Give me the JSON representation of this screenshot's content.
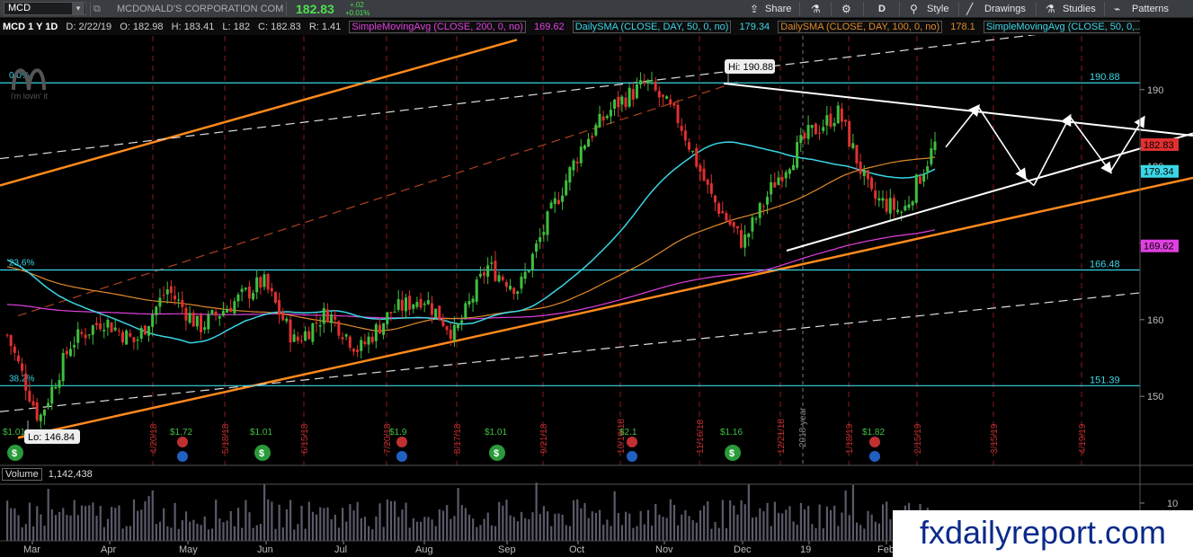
{
  "toolbar": {
    "symbol": "MCD",
    "company": "MCDONALD'S CORPORATION COM",
    "last": "182.83",
    "change": "+.02",
    "change_pct": "+0.01%",
    "share_label": "Share",
    "interval_label": "D",
    "style_label": "Style",
    "drawings_label": "Drawings",
    "studies_label": "Studies",
    "patterns_label": "Patterns"
  },
  "studies": {
    "title": "MCD 1 Y 1D",
    "date": "D: 2/22/19",
    "open": "O: 182.98",
    "high": "H: 183.41",
    "low": "L: 182",
    "close": "C: 182.83",
    "range": "R: 1.41",
    "sma200_label": "SimpleMovingAvg (CLOSE, 200, 0, no)",
    "sma200_value": "169.62",
    "sma50_label": "DailySMA (CLOSE, DAY, 50, 0, no)",
    "sma50_value": "179.34",
    "sma100_label": "DailySMA (CLOSE, DAY, 100, 0, no)",
    "sma100_value": "178.1",
    "sma50b_label": "SimpleMovingAvg (CLOSE, 50, 0,..."
  },
  "logo_text": "i'm lovin' it",
  "watermark": "fxdailyreport.com",
  "volume": {
    "label": "Volume",
    "value": "1,142,438",
    "axis_tick": "10"
  },
  "colors": {
    "background": "#000000",
    "up_candle": "#3fbf3f",
    "down_candle": "#e03030",
    "sma50": "#3ad6e6",
    "sma100": "#e08a2a",
    "sma200": "#e040e0",
    "fib_line": "#3ad6e6",
    "channel_line": "#ff8a1c",
    "trend_line": "#ffffff"
  },
  "chart_data": {
    "type": "candlestick",
    "symbol": "MCD",
    "period": "1 Y 1D",
    "ylim": [
      141,
      197
    ],
    "y_ticks": [
      150,
      160,
      170,
      180,
      190
    ],
    "x_months": [
      "Mar",
      "Apr",
      "May",
      "Jun",
      "Jul",
      "Aug",
      "Sep",
      "Oct",
      "Nov",
      "Dec",
      "19",
      "Feb"
    ],
    "year_marker": "2018 year",
    "price_labels": [
      {
        "text": "190.88",
        "value": 190.88,
        "color": "#3ad6e6",
        "style": "text"
      },
      {
        "text": "182.83",
        "value": 182.83,
        "color": "#e03030",
        "style": "box"
      },
      {
        "text": "179.34",
        "value": 179.34,
        "color": "#3ad6e6",
        "style": "box"
      },
      {
        "text": "169.62",
        "value": 169.62,
        "color": "#e040e0",
        "style": "box"
      },
      {
        "text": "166.48",
        "value": 166.48,
        "color": "#3ad6e6",
        "style": "text"
      },
      {
        "text": "151.39",
        "value": 151.39,
        "color": "#3ad6e6",
        "style": "text"
      }
    ],
    "fib_levels": [
      {
        "label": "0.0%",
        "value": 190.88
      },
      {
        "label": "23.6%",
        "value": 166.48
      },
      {
        "label": "38.2%",
        "value": 151.39
      }
    ],
    "high_label": "Hi: 190.88",
    "low_label": "Lo: 146.84",
    "event_dates": [
      "4/20/18",
      "5/18/18",
      "6/15/18",
      "7/20/18",
      "8/17/18",
      "9/21/18",
      "10/19/18",
      "11/16/18",
      "12/21/18",
      "1/18/19",
      "2/15/19",
      "3/15/19",
      "4/19/19"
    ],
    "dividends": [
      "$1.01",
      "$1.72",
      "$1.01",
      "$1.9",
      "$1.01",
      "$2.1",
      "$1.16",
      "$1.82"
    ],
    "price_path": [
      {
        "x": "Mar",
        "y": 158
      },
      {
        "x": "early Mar",
        "y": 147
      },
      {
        "x": "Mar",
        "y": 157
      },
      {
        "x": "Apr",
        "y": 160
      },
      {
        "x": "Apr",
        "y": 157
      },
      {
        "x": "May",
        "y": 164
      },
      {
        "x": "May",
        "y": 159
      },
      {
        "x": "Jun",
        "y": 162
      },
      {
        "x": "Jun",
        "y": 165
      },
      {
        "x": "Jul",
        "y": 157
      },
      {
        "x": "Jul",
        "y": 161
      },
      {
        "x": "Aug",
        "y": 156
      },
      {
        "x": "Aug",
        "y": 161
      },
      {
        "x": "Sep",
        "y": 163
      },
      {
        "x": "Sep",
        "y": 158
      },
      {
        "x": "Oct",
        "y": 167
      },
      {
        "x": "Oct",
        "y": 164
      },
      {
        "x": "Oct",
        "y": 174
      },
      {
        "x": "Nov",
        "y": 183
      },
      {
        "x": "Nov",
        "y": 188
      },
      {
        "x": "Nov",
        "y": 190.88
      },
      {
        "x": "Dec",
        "y": 186
      },
      {
        "x": "Dec",
        "y": 176
      },
      {
        "x": "Dec",
        "y": 170
      },
      {
        "x": "19",
        "y": 178
      },
      {
        "x": "19",
        "y": 184
      },
      {
        "x": "19",
        "y": 187
      },
      {
        "x": "Feb",
        "y": 176
      },
      {
        "x": "Feb",
        "y": 174
      },
      {
        "x": "Feb",
        "y": 182.83
      }
    ]
  }
}
